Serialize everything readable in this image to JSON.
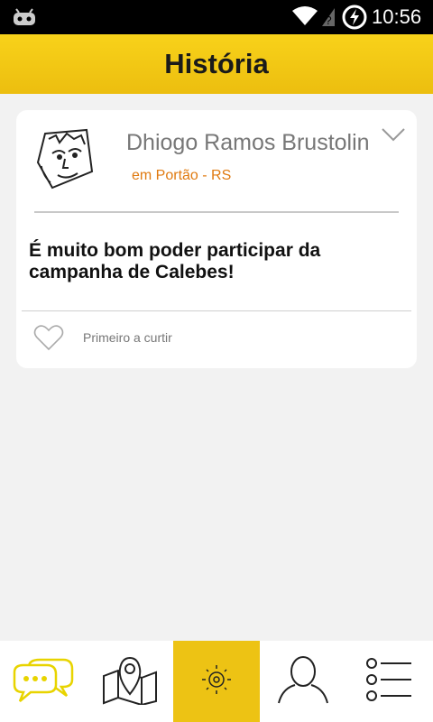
{
  "status_bar": {
    "time": "10:56",
    "icons": [
      "cyanogen-robot-icon",
      "wifi-icon",
      "no-sim-signal-icon",
      "battery-charging-icon"
    ]
  },
  "app_bar": {
    "title": "História"
  },
  "post": {
    "author_name": "Dhiogo Ramos Brustolin",
    "location": "em Portão - RS",
    "message": "É muito bom poder participar da campanha de Calebes!",
    "like_text": "Primeiro a curtir"
  },
  "bottom_nav": {
    "items": [
      {
        "icon": "chat-bubbles-icon",
        "active": false
      },
      {
        "icon": "map-pin-icon",
        "active": false
      },
      {
        "icon": "location-target-icon",
        "active": true
      },
      {
        "icon": "profile-icon",
        "active": false
      },
      {
        "icon": "list-icon",
        "active": false
      }
    ]
  },
  "colors": {
    "accent": "#edc314",
    "location_text": "#e07a10",
    "status_bar": "#000000",
    "background": "#f2f2f2"
  }
}
